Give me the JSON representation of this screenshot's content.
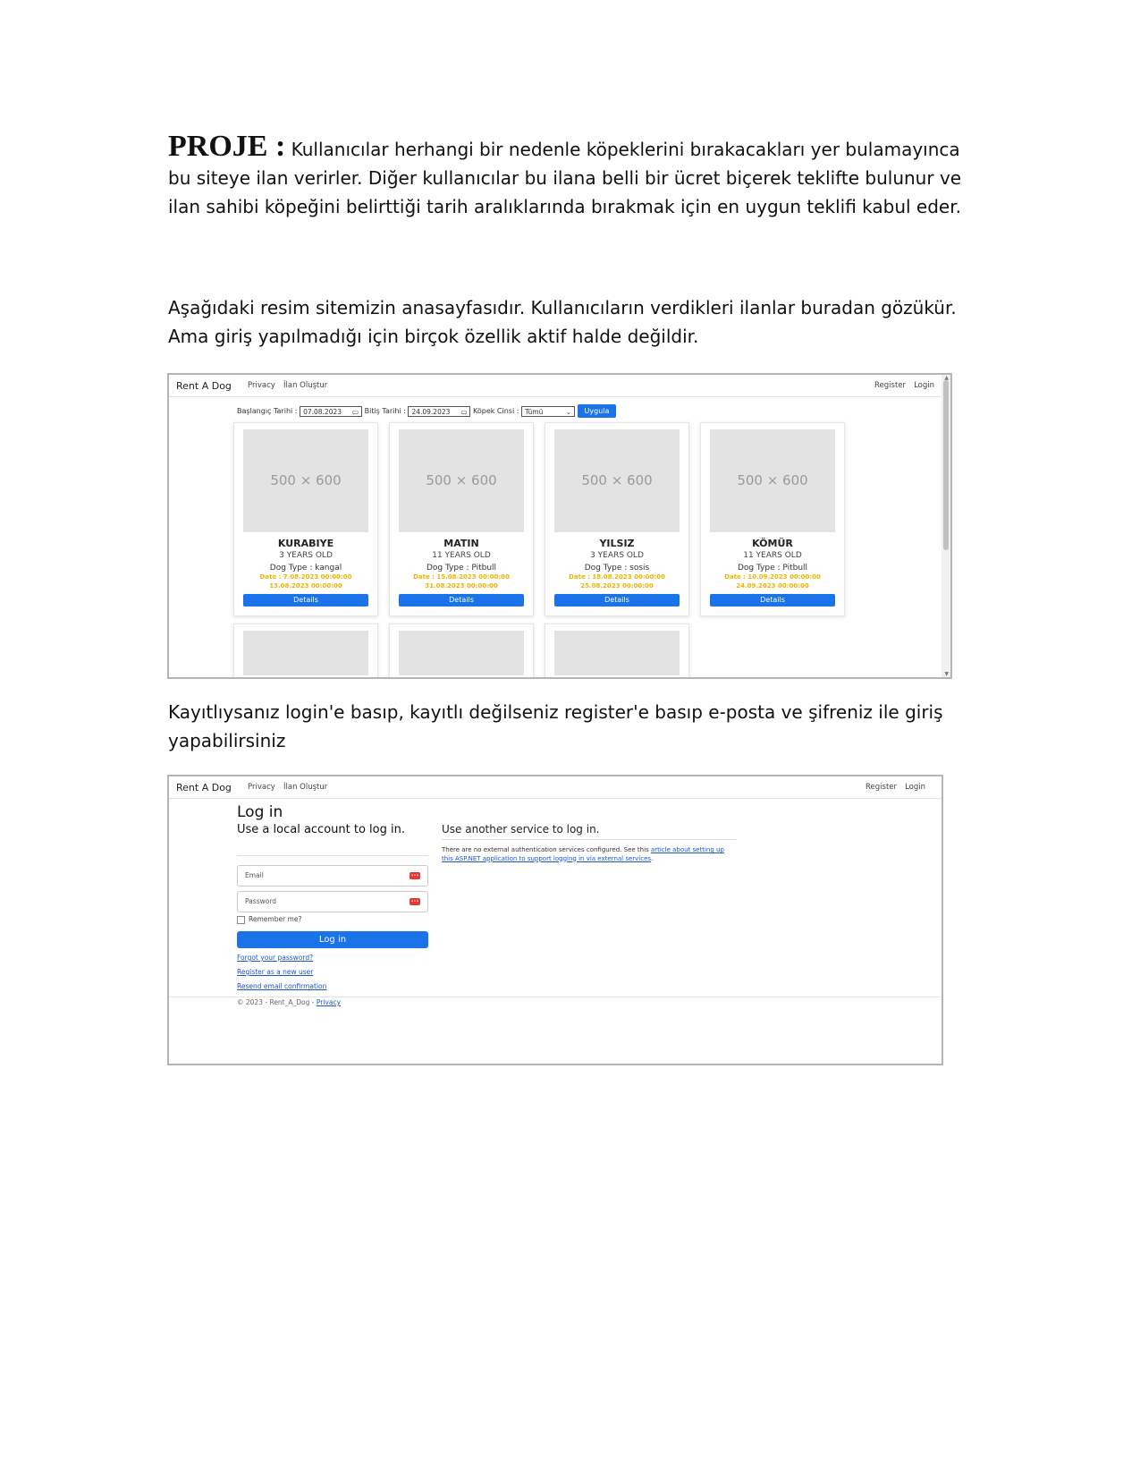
{
  "intro": {
    "label": "PROJE :",
    "text": "Kullanıcılar herhangi bir nedenle köpeklerini bırakacakları yer bulamayınca bu siteye ilan verirler. Diğer kullanıcılar bu ilana belli bir ücret biçerek teklifte bulunur ve ilan sahibi köpeğini belirttiği tarih aralıklarında bırakmak için en uygun teklifi kabul eder."
  },
  "para2": "Aşağıdaki resim sitemizin anasayfasıdır. Kullanıcıların verdikleri ilanlar buradan gözükür. Ama giriş yapılmadığı için birçok özellik aktif halde değildir.",
  "para3": "Kayıtlıysanız login'e basıp, kayıtlı değilseniz register'e basıp e-posta ve şifreniz ile giriş yapabilirsiniz",
  "home": {
    "nav": {
      "brand": "Rent A Dog",
      "privacy": "Privacy",
      "create": "İlan Oluştur",
      "register": "Register",
      "login": "Login"
    },
    "filter": {
      "start_label": "Başlangıç Tarihi :",
      "start_value": "07.08.2023",
      "end_label": "Bitiş Tarihi :",
      "end_value": "24.09.2023",
      "breed_label": "Köpek Cinsi :",
      "breed_value": "Tümü",
      "apply": "Uygula"
    },
    "cards": [
      {
        "placeholder": "500 × 600",
        "name": "KURABIYE",
        "age": "3 YEARS OLD",
        "type": "Dog Type : kangal",
        "date1": "Date : 7.08.2023 00:00:00",
        "date2": "13.08.2023 00:00:00",
        "button": "Details"
      },
      {
        "placeholder": "500 × 600",
        "name": "MATIN",
        "age": "11 YEARS OLD",
        "type": "Dog Type : Pitbull",
        "date1": "Date : 15.08.2023 00:00:00",
        "date2": "31.08.2023 00:00:00",
        "button": "Details"
      },
      {
        "placeholder": "500 × 600",
        "name": "YILSIZ",
        "age": "3 YEARS OLD",
        "type": "Dog Type : sosis",
        "date1": "Date : 18.08.2023 00:00:00",
        "date2": "25.08.2023 00:00:00",
        "button": "Details"
      },
      {
        "placeholder": "500 × 600",
        "name": "KÖMÜR",
        "age": "11 YEARS OLD",
        "type": "Dog Type : Pitbull",
        "date1": "Date : 10.09.2023 00:00:00",
        "date2": "24.09.2023 00:00:00",
        "button": "Details"
      }
    ]
  },
  "login": {
    "nav": {
      "brand": "Rent A Dog",
      "privacy": "Privacy",
      "create": "İlan Oluştur",
      "register": "Register",
      "login": "Login"
    },
    "title": "Log in",
    "subtitle": "Use a local account to log in.",
    "email_placeholder": "Email",
    "password_placeholder": "Password",
    "remember": "Remember me?",
    "submit": "Log in",
    "forgot": "Forgot your password?",
    "register_link": "Register as a new user",
    "resend": "Resend email confirmation",
    "other_title": "Use another service to log in.",
    "other_text": "There are no external authentication services configured. See this",
    "other_link": "article about setting up this ASP.NET application to support logging in via external services",
    "other_end": ".",
    "footer_text": "© 2023 - Rent_A_Dog -",
    "footer_link": "Privacy"
  }
}
